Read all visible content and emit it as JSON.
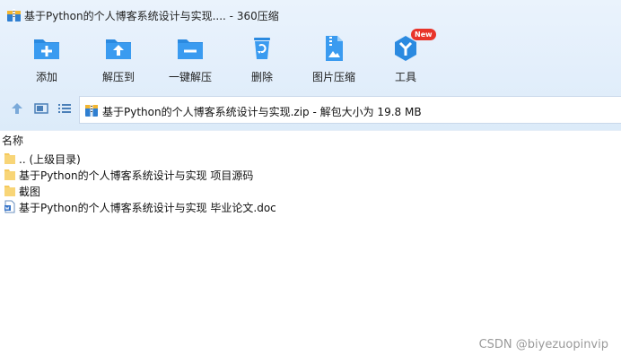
{
  "window": {
    "title": "基于Python的个人博客系统设计与实现.... - 360压缩"
  },
  "toolbar": {
    "items": [
      {
        "label": "添加",
        "icon": "add-icon"
      },
      {
        "label": "解压到",
        "icon": "extract-to-icon"
      },
      {
        "label": "一键解压",
        "icon": "one-click-extract-icon"
      },
      {
        "label": "删除",
        "icon": "delete-icon"
      },
      {
        "label": "图片压缩",
        "icon": "image-compress-icon"
      },
      {
        "label": "工具",
        "icon": "tools-icon",
        "badge": "New"
      }
    ]
  },
  "address": {
    "path": "基于Python的个人博客系统设计与实现.zip - 解包大小为 19.8 MB"
  },
  "list": {
    "header": "名称",
    "items": [
      {
        "name": ".. (上级目录)",
        "type": "folder"
      },
      {
        "name": "基于Python的个人博客系统设计与实现 项目源码",
        "type": "folder"
      },
      {
        "name": "截图",
        "type": "folder"
      },
      {
        "name": "基于Python的个人博客系统设计与实现 毕业论文.doc",
        "type": "doc"
      }
    ]
  },
  "watermark": "CSDN @biyezuopinvip",
  "colors": {
    "accent": "#1e88d8",
    "folder": "#f5c95c",
    "badge": "#e8342a"
  }
}
